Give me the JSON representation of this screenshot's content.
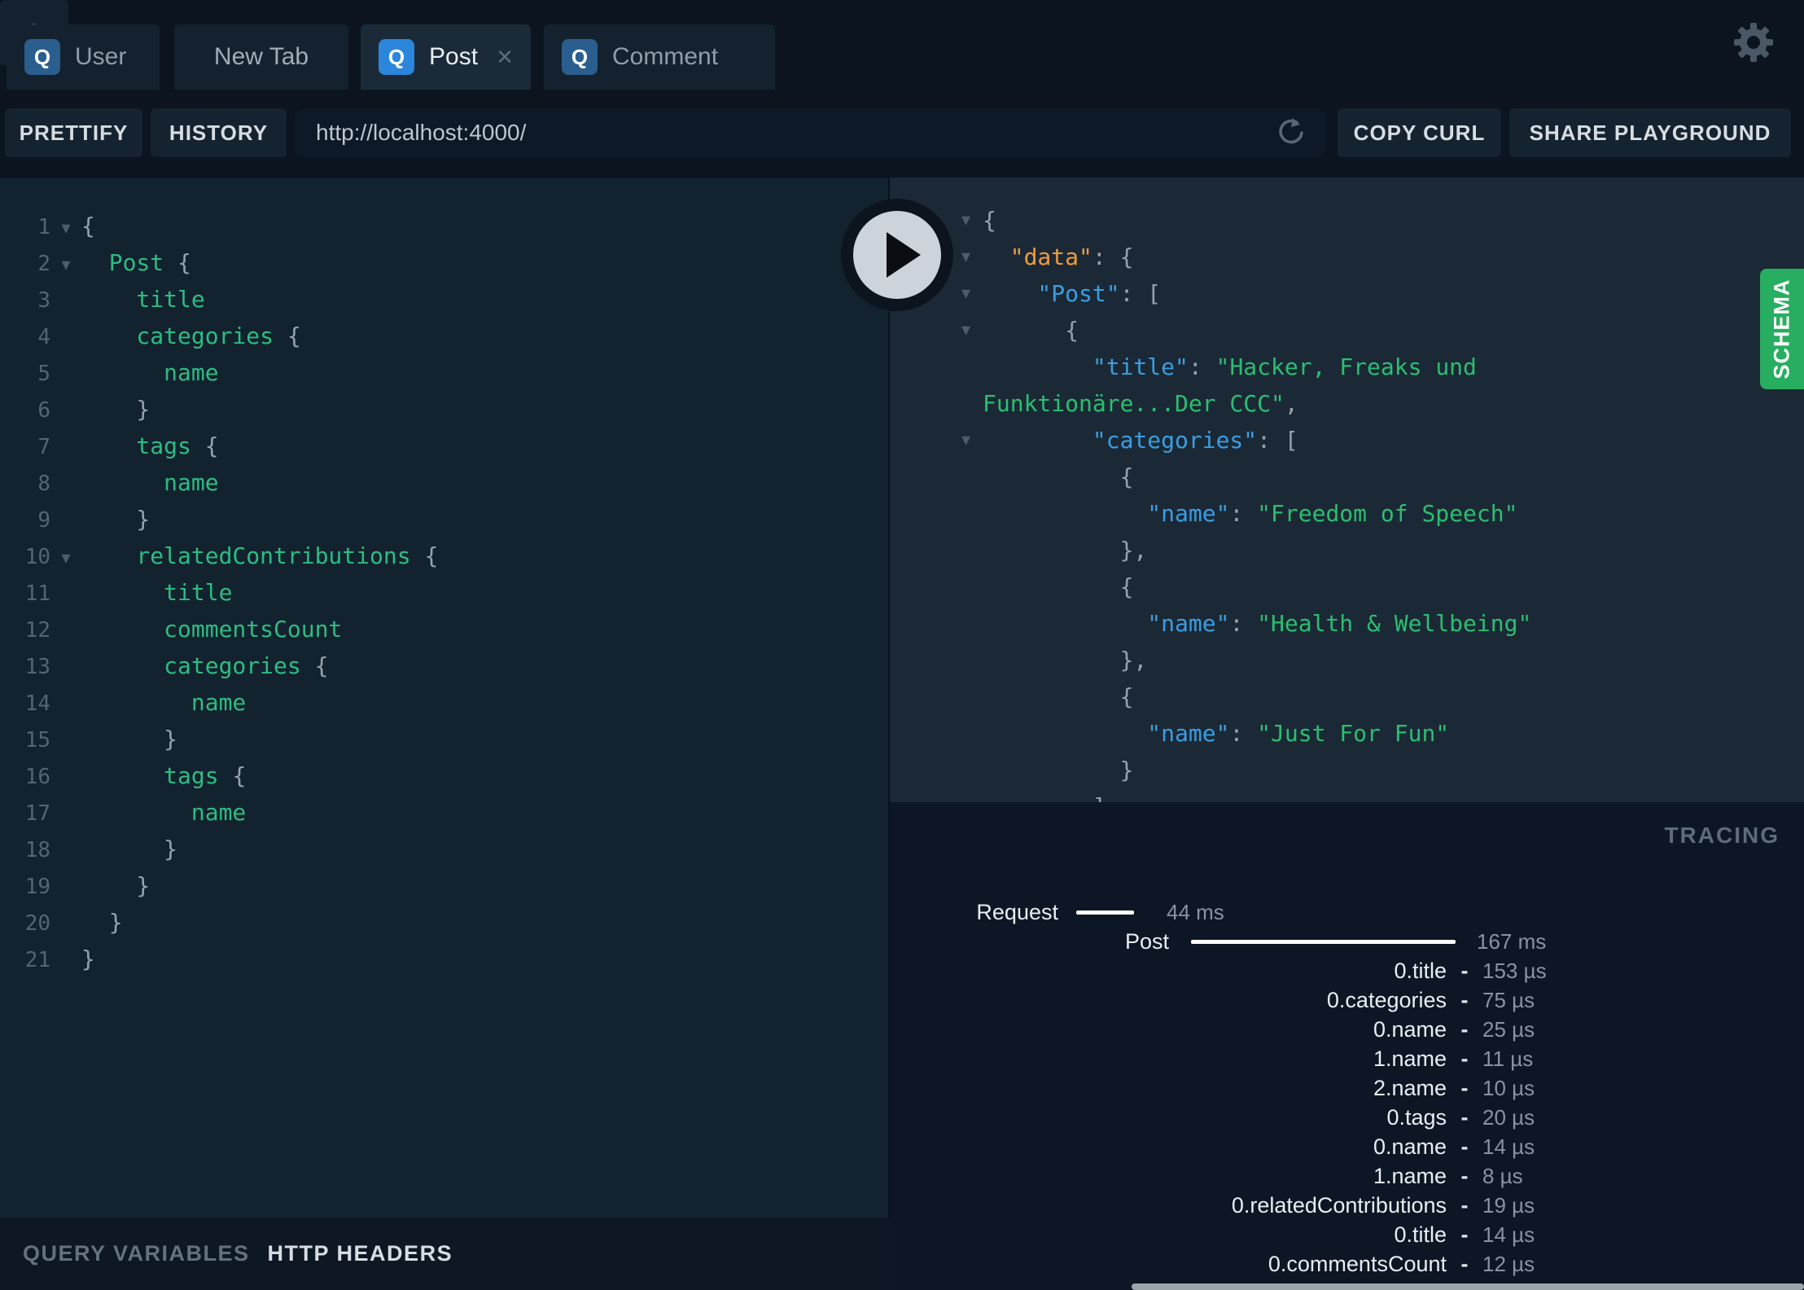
{
  "colors": {
    "top_bar_bg": "#0b141f",
    "tab_bg": "#14222f",
    "tab_active_bg": "#1b2a38",
    "q_badge": "#2a5e8e",
    "q_badge_active": "#2b86dc",
    "editor_bg": "#13222f",
    "response_bg": "#1b2936",
    "tracing_bg": "#0c1624",
    "schema_green": "#27ae60",
    "code_green": "#2cbd80",
    "json_key_blue": "#3a9ee2",
    "json_data_orange": "#f09b3c",
    "json_string_green": "#2abf70"
  },
  "tabs": {
    "items": [
      {
        "label": "User",
        "badge": "Q",
        "active": false,
        "closable": false
      },
      {
        "label": "New Tab",
        "badge": null,
        "active": false,
        "closable": false
      },
      {
        "label": "Post",
        "badge": "Q",
        "active": true,
        "closable": true
      },
      {
        "label": "Comment",
        "badge": "Q",
        "active": false,
        "closable": false
      }
    ],
    "add_label": "+",
    "close_glyph": "×"
  },
  "toolbar": {
    "prettify": "PRETTIFY",
    "history": "HISTORY",
    "url": "http://localhost:4000/",
    "copy_curl": "COPY CURL",
    "share_playground": "SHARE PLAYGROUND"
  },
  "editor": {
    "fold_glyph": "▾",
    "lines": [
      {
        "n": 1,
        "fold": true,
        "segs": [
          [
            "p",
            "{"
          ]
        ]
      },
      {
        "n": 2,
        "fold": true,
        "segs": [
          [
            "f",
            "  Post "
          ],
          [
            "p",
            "{"
          ]
        ]
      },
      {
        "n": 3,
        "fold": false,
        "segs": [
          [
            "f",
            "    title"
          ]
        ]
      },
      {
        "n": 4,
        "fold": false,
        "segs": [
          [
            "f",
            "    categories "
          ],
          [
            "p",
            "{"
          ]
        ]
      },
      {
        "n": 5,
        "fold": false,
        "segs": [
          [
            "f",
            "      name"
          ]
        ]
      },
      {
        "n": 6,
        "fold": false,
        "segs": [
          [
            "p",
            "    }"
          ]
        ]
      },
      {
        "n": 7,
        "fold": false,
        "segs": [
          [
            "f",
            "    tags "
          ],
          [
            "p",
            "{"
          ]
        ]
      },
      {
        "n": 8,
        "fold": false,
        "segs": [
          [
            "f",
            "      name"
          ]
        ]
      },
      {
        "n": 9,
        "fold": false,
        "segs": [
          [
            "p",
            "    }"
          ]
        ]
      },
      {
        "n": 10,
        "fold": true,
        "segs": [
          [
            "f",
            "    relatedContributions "
          ],
          [
            "p",
            "{"
          ]
        ]
      },
      {
        "n": 11,
        "fold": false,
        "segs": [
          [
            "f",
            "      title"
          ]
        ]
      },
      {
        "n": 12,
        "fold": false,
        "segs": [
          [
            "f",
            "      commentsCount"
          ]
        ]
      },
      {
        "n": 13,
        "fold": false,
        "segs": [
          [
            "f",
            "      categories "
          ],
          [
            "p",
            "{"
          ]
        ]
      },
      {
        "n": 14,
        "fold": false,
        "segs": [
          [
            "f",
            "        name"
          ]
        ]
      },
      {
        "n": 15,
        "fold": false,
        "segs": [
          [
            "p",
            "      }"
          ]
        ]
      },
      {
        "n": 16,
        "fold": false,
        "segs": [
          [
            "f",
            "      tags "
          ],
          [
            "p",
            "{"
          ]
        ]
      },
      {
        "n": 17,
        "fold": false,
        "segs": [
          [
            "f",
            "        name"
          ]
        ]
      },
      {
        "n": 18,
        "fold": false,
        "segs": [
          [
            "p",
            "      }"
          ]
        ]
      },
      {
        "n": 19,
        "fold": false,
        "segs": [
          [
            "p",
            "    }"
          ]
        ]
      },
      {
        "n": 20,
        "fold": false,
        "segs": [
          [
            "p",
            "  }"
          ]
        ]
      },
      {
        "n": 21,
        "fold": false,
        "segs": [
          [
            "p",
            "}"
          ]
        ]
      }
    ]
  },
  "response": {
    "lines": [
      {
        "fold": true,
        "segs": [
          [
            "p",
            "{"
          ]
        ]
      },
      {
        "fold": true,
        "segs": [
          [
            "o",
            "  \"data\""
          ],
          [
            "p",
            ": {"
          ]
        ]
      },
      {
        "fold": true,
        "segs": [
          [
            "k",
            "    \"Post\""
          ],
          [
            "p",
            ": ["
          ]
        ]
      },
      {
        "fold": true,
        "segs": [
          [
            "p",
            "      {"
          ]
        ]
      },
      {
        "fold": false,
        "segs": [
          [
            "k",
            "        \"title\""
          ],
          [
            "p",
            ": "
          ],
          [
            "s",
            "\"Hacker, Freaks und"
          ]
        ]
      },
      {
        "fold": false,
        "segs": [
          [
            "s",
            "Funktionäre...Der CCC\""
          ],
          [
            "p",
            ","
          ]
        ]
      },
      {
        "fold": true,
        "segs": [
          [
            "k",
            "        \"categories\""
          ],
          [
            "p",
            ": ["
          ]
        ]
      },
      {
        "fold": false,
        "segs": [
          [
            "p",
            "          {"
          ]
        ]
      },
      {
        "fold": false,
        "segs": [
          [
            "k",
            "            \"name\""
          ],
          [
            "p",
            ": "
          ],
          [
            "s",
            "\"Freedom of Speech\""
          ]
        ]
      },
      {
        "fold": false,
        "segs": [
          [
            "p",
            "          },"
          ]
        ]
      },
      {
        "fold": false,
        "segs": [
          [
            "p",
            "          {"
          ]
        ]
      },
      {
        "fold": false,
        "segs": [
          [
            "k",
            "            \"name\""
          ],
          [
            "p",
            ": "
          ],
          [
            "s",
            "\"Health & Wellbeing\""
          ]
        ]
      },
      {
        "fold": false,
        "segs": [
          [
            "p",
            "          },"
          ]
        ]
      },
      {
        "fold": false,
        "segs": [
          [
            "p",
            "          {"
          ]
        ]
      },
      {
        "fold": false,
        "segs": [
          [
            "k",
            "            \"name\""
          ],
          [
            "p",
            ": "
          ],
          [
            "s",
            "\"Just For Fun\""
          ]
        ]
      },
      {
        "fold": false,
        "segs": [
          [
            "p",
            "          }"
          ]
        ]
      },
      {
        "fold": false,
        "segs": [
          [
            "p",
            "        ]"
          ]
        ]
      }
    ]
  },
  "schema_tab": {
    "label": "SCHEMA"
  },
  "tracing": {
    "title": "TRACING",
    "request": {
      "label": "Request",
      "time": "44 ms"
    },
    "root_resolver": {
      "label": "Post",
      "time": "167 ms"
    },
    "rows": [
      {
        "label": "0.title",
        "time": "153 µs"
      },
      {
        "label": "0.categories",
        "time": "75 µs"
      },
      {
        "label": "0.name",
        "time": "25 µs"
      },
      {
        "label": "1.name",
        "time": "11 µs"
      },
      {
        "label": "2.name",
        "time": "10 µs"
      },
      {
        "label": "0.tags",
        "time": "20 µs"
      },
      {
        "label": "0.name",
        "time": "14 µs"
      },
      {
        "label": "1.name",
        "time": "8 µs"
      },
      {
        "label": "0.relatedContributions",
        "time": "19 µs"
      },
      {
        "label": "0.title",
        "time": "14 µs"
      },
      {
        "label": "0.commentsCount",
        "time": "12 µs"
      }
    ],
    "dash_glyph": "-"
  },
  "bottom_bar": {
    "query_variables": "QUERY VARIABLES",
    "http_headers": "HTTP HEADERS"
  }
}
